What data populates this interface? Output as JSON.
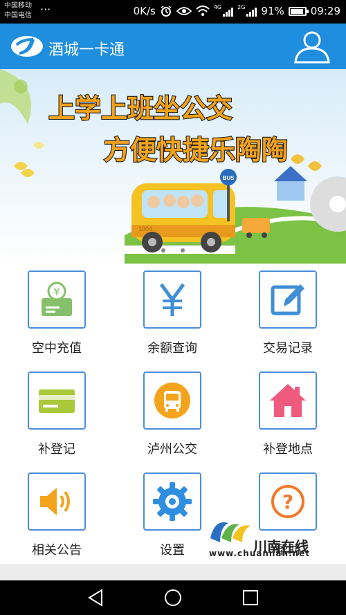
{
  "status_bar": {
    "carrier_1": "中国移动",
    "carrier_2": "中国电信",
    "overflow": "···",
    "speed": "0K/s",
    "net_tag_1": "4G",
    "net_tag_2": "2G",
    "battery": "91%",
    "battery_level": 0.91,
    "time": "09:29"
  },
  "header": {
    "title": "酒城一卡通",
    "accent": "#1f8ede",
    "logo_icon": "app-logo-icon",
    "user_icon": "user-profile-icon"
  },
  "banner": {
    "line_1": "上学上班坐公交",
    "line_2": "方便快捷乐陶陶",
    "bus_sign": "BUS",
    "bus_number": "1004"
  },
  "menu": [
    {
      "label": "空中充值",
      "icon": "recharge-card-icon"
    },
    {
      "label": "余额查询",
      "icon": "yen-icon"
    },
    {
      "label": "交易记录",
      "icon": "edit-record-icon"
    },
    {
      "label": "补登记",
      "icon": "card-icon"
    },
    {
      "label": "泸州公交",
      "icon": "bus-icon"
    },
    {
      "label": "补登地点",
      "icon": "home-icon"
    },
    {
      "label": "相关公告",
      "icon": "speaker-icon"
    },
    {
      "label": "设置",
      "icon": "gear-icon"
    },
    {
      "label": "帮助",
      "icon": "help-icon"
    }
  ],
  "watermark": {
    "text": "川南在线",
    "url": "www.chuannan.net"
  },
  "nav": {
    "back_icon": "back-icon",
    "home_icon": "home-circle-icon",
    "recents_icon": "recents-icon"
  }
}
